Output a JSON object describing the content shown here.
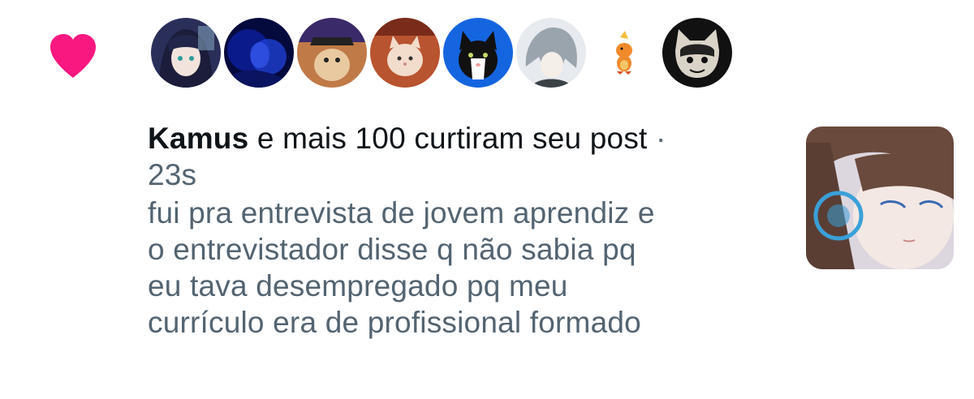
{
  "notification": {
    "type_icon": "heart-icon",
    "heart_color": "#f91880",
    "avatars": [
      {
        "name": "avatar-1",
        "colors": [
          "#2a2f5a",
          "#8fb6c9",
          "#1b1d3a"
        ]
      },
      {
        "name": "avatar-2",
        "colors": [
          "#0a1a8a",
          "#1e3fd1",
          "#050a3d"
        ]
      },
      {
        "name": "avatar-3",
        "colors": [
          "#c07a48",
          "#3b2a6a",
          "#e8c9a0"
        ]
      },
      {
        "name": "avatar-4",
        "colors": [
          "#b8542f",
          "#f2dccb",
          "#7a2c1a"
        ]
      },
      {
        "name": "avatar-5",
        "colors": [
          "#1565e0",
          "#111111",
          "#ffffff"
        ]
      },
      {
        "name": "avatar-6",
        "colors": [
          "#e7eaee",
          "#9aa4ad",
          "#3a4248"
        ]
      },
      {
        "name": "avatar-7",
        "colors": [
          "#ffffff",
          "#f08a2a",
          "#d94f1e"
        ]
      },
      {
        "name": "avatar-8",
        "colors": [
          "#111111",
          "#d9d3c8",
          "#222222"
        ]
      }
    ],
    "actor_name": "Kamus",
    "action_text": " e mais 100 curtiram seu post",
    "separator": " ·",
    "time": "23s",
    "post_lines": [
      "fui pra entrevista de jovem aprendiz e",
      "o entrevistador disse q não sabia pq",
      "eu tava desempregado pq meu",
      "currículo era de profissional formado"
    ],
    "thumbnail_colors": [
      "#dcd6df",
      "#6a4a3c",
      "#3aa0d8",
      "#f4e8e4"
    ]
  }
}
